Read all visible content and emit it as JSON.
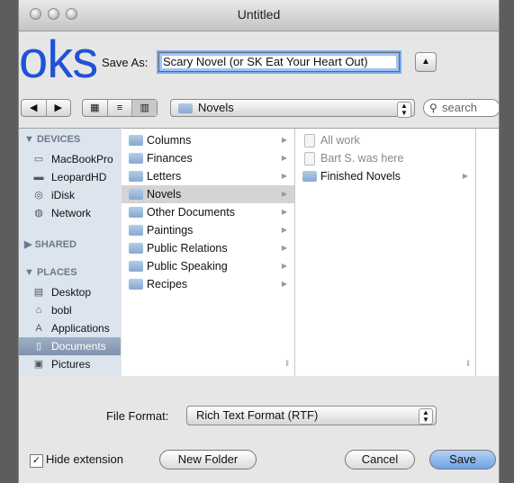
{
  "window": {
    "title": "Untitled"
  },
  "overlay": {
    "text": "oks"
  },
  "save_as": {
    "label": "Save As:",
    "value": "Scary Novel (or SK Eat Your Heart Out)"
  },
  "toolbar": {
    "back_label": "◀",
    "forward_label": "▶",
    "view_icons": [
      "▦",
      "≡",
      "▥"
    ],
    "folder": "Novels",
    "search_placeholder": "search"
  },
  "sidebar": {
    "devices": {
      "label": "▼ DEVICES",
      "items": [
        "MacBookPro",
        "LeopardHD",
        "iDisk",
        "Network"
      ]
    },
    "shared": {
      "label": "▶ SHARED"
    },
    "places": {
      "label": "▼ PLACES",
      "items": [
        "Desktop",
        "bobl",
        "Applications",
        "Documents",
        "Pictures"
      ]
    }
  },
  "columns": {
    "col1": [
      "Columns",
      "Finances",
      "Letters",
      "Novels",
      "Other Documents",
      "Paintings",
      "Public Relations",
      "Public Speaking",
      "Recipes"
    ],
    "col2": [
      "All work",
      "Bart S. was here",
      "Finished Novels"
    ]
  },
  "bottom": {
    "file_format_label": "File Format:",
    "file_format_value": "Rich Text Format (RTF)",
    "hide_extension_label": "Hide extension",
    "new_folder_label": "New Folder",
    "cancel_label": "Cancel",
    "save_label": "Save"
  }
}
